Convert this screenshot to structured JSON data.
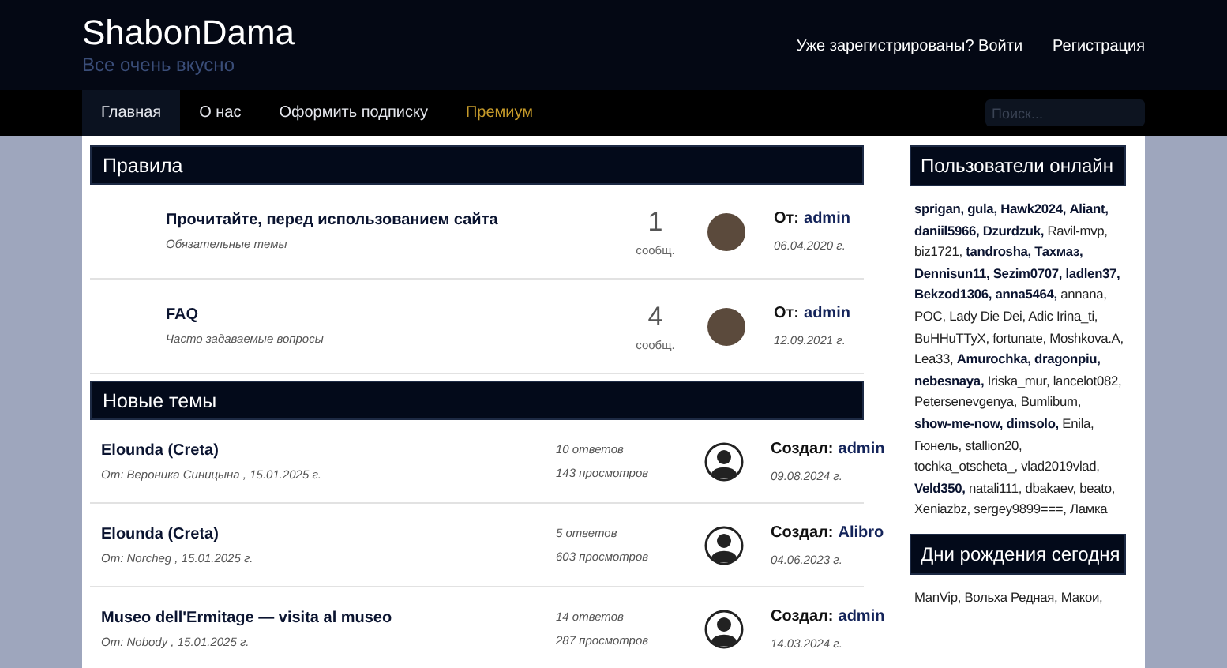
{
  "header": {
    "title": "ShabonDama",
    "tagline": "Все очень вкусно",
    "links": [
      "Уже зарегистрированы? Войти",
      "Регистрация"
    ]
  },
  "nav": {
    "items": [
      {
        "label": "Главная",
        "selected": true,
        "kind": "normal"
      },
      {
        "label": "О нас",
        "selected": false,
        "kind": "normal"
      },
      {
        "label": "Оформить подписку",
        "selected": false,
        "kind": "normal"
      },
      {
        "label": "Премиум",
        "selected": false,
        "kind": "premium"
      }
    ],
    "search": {
      "placeholder": "Поиск..."
    }
  },
  "rules": {
    "title": "Правила",
    "rows": [
      {
        "title": "Прочитайте, перед использованием сайта",
        "subtitle": "Обязательные темы",
        "count": "1",
        "count_label": "сообщ.",
        "author_prefix": "От:",
        "author": "admin",
        "date": "06.04.2020 г."
      },
      {
        "title": "FAQ",
        "subtitle": "Часто задаваемые вопросы",
        "count": "4",
        "count_label": "сообщ.",
        "author_prefix": "От:",
        "author": "admin",
        "date": "12.09.2021 г."
      }
    ]
  },
  "new_topics": {
    "title": "Новые темы",
    "rows": [
      {
        "title": "Elounda (Creta)",
        "meta": "От: Вероника Синицына , 15.01.2025 г.",
        "replies": "10 ответов",
        "views": "143 просмотров",
        "author_prefix": "Создал:",
        "author": "admin",
        "date": "09.08.2024 г."
      },
      {
        "title": "Elounda (Creta)",
        "meta": "От: Norcheg , 15.01.2025 г.",
        "replies": "5 ответов",
        "views": "603 просмотров",
        "author_prefix": "Создал:",
        "author": "Alibro",
        "date": "04.06.2023 г."
      },
      {
        "title": "Museo dell'Ermitage — visita al museo",
        "meta": "От: Nobody , 15.01.2025 г.",
        "replies": "14 ответов",
        "views": "287 просмотров",
        "author_prefix": "Создал:",
        "author": "admin",
        "date": "14.03.2024 г."
      }
    ]
  },
  "online": {
    "title": "Пользователи онлайн",
    "users": [
      {
        "name": "sprigan,",
        "bold": true
      },
      {
        "name": "gula,",
        "bold": true
      },
      {
        "name": "Hawk2024,",
        "bold": true
      },
      {
        "name": "Aliant,",
        "bold": true
      },
      {
        "name": "daniil5966,",
        "bold": true
      },
      {
        "name": "Dzurdzuk,",
        "bold": true
      },
      {
        "name": "Ravil-mvp,",
        "bold": false
      },
      {
        "name": "biz1721,",
        "bold": false
      },
      {
        "name": "tandrosha,",
        "bold": true
      },
      {
        "name": "Тахмаз,",
        "bold": true
      },
      {
        "name": "Dennisun11,",
        "bold": true
      },
      {
        "name": "Sezim0707,",
        "bold": true
      },
      {
        "name": "ladlen37,",
        "bold": true
      },
      {
        "name": "Bekzod1306,",
        "bold": true
      },
      {
        "name": "anna5464,",
        "bold": true
      },
      {
        "name": "annana,",
        "bold": false
      },
      {
        "name": "POC,",
        "bold": false
      },
      {
        "name": "Lady Die Dei,",
        "bold": false
      },
      {
        "name": "Adic Irina_ti,",
        "bold": false
      },
      {
        "name": "BuHHuTTyX,",
        "bold": false
      },
      {
        "name": "fortunate,",
        "bold": false
      },
      {
        "name": "Moshkova.A,",
        "bold": false
      },
      {
        "name": "Lea33,",
        "bold": false
      },
      {
        "name": "Amurochka,",
        "bold": true
      },
      {
        "name": "dragonpiu,",
        "bold": true
      },
      {
        "name": "nebesnaya,",
        "bold": true
      },
      {
        "name": "Iriska_mur,",
        "bold": false
      },
      {
        "name": "lancelot082,",
        "bold": false
      },
      {
        "name": "Petersenevgenya,",
        "bold": false
      },
      {
        "name": "Bumlibum,",
        "bold": false
      },
      {
        "name": "show-me-now,",
        "bold": true
      },
      {
        "name": "dimsolo,",
        "bold": true
      },
      {
        "name": "Enila,",
        "bold": false
      },
      {
        "name": "Гюнель,",
        "bold": false
      },
      {
        "name": "stallion20,",
        "bold": false
      },
      {
        "name": "tochka_otscheta_,",
        "bold": false
      },
      {
        "name": "vlad2019vlad,",
        "bold": false
      },
      {
        "name": "Veld350,",
        "bold": true
      },
      {
        "name": "natali111,",
        "bold": false
      },
      {
        "name": "dbakaev,",
        "bold": false
      },
      {
        "name": "beato,",
        "bold": false
      },
      {
        "name": "Xeniazbz,",
        "bold": false
      },
      {
        "name": "sergey9899===,",
        "bold": false
      },
      {
        "name": "Ламка",
        "bold": false
      }
    ]
  },
  "birthdays": {
    "title": "Дни рождения сегодня",
    "users": [
      "ManVip,",
      "Вольха Редная,",
      "Макои,"
    ]
  }
}
